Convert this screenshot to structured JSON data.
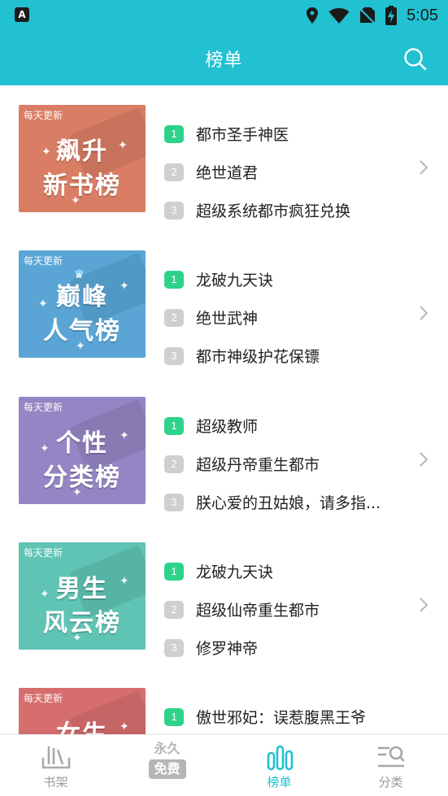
{
  "status": {
    "app_badge": "A",
    "time": "5:05"
  },
  "appbar": {
    "title": "榜单"
  },
  "colors": {
    "primary": "#22C1D2",
    "badge_first": "#2DD38A",
    "badge_other": "#CFCFCF"
  },
  "rankings": [
    {
      "cover_tag": "每天更新",
      "cover_line1": "飙升",
      "cover_line2": "新书榜",
      "cover_color": "#D97D64",
      "items": [
        {
          "rank": "1",
          "title": "都市圣手神医"
        },
        {
          "rank": "2",
          "title": "绝世道君"
        },
        {
          "rank": "3",
          "title": "超级系统都市疯狂兑换"
        }
      ]
    },
    {
      "cover_tag": "每天更新",
      "cover_line1": "巅峰",
      "cover_line2": "人气榜",
      "cover_color": "#5AA5D6",
      "items": [
        {
          "rank": "1",
          "title": "龙破九天诀"
        },
        {
          "rank": "2",
          "title": "绝世武神"
        },
        {
          "rank": "3",
          "title": "都市神级护花保镖"
        }
      ]
    },
    {
      "cover_tag": "每天更新",
      "cover_line1": "个性",
      "cover_line2": "分类榜",
      "cover_color": "#9486C4",
      "items": [
        {
          "rank": "1",
          "title": "超级教师"
        },
        {
          "rank": "2",
          "title": "超级丹帝重生都市"
        },
        {
          "rank": "3",
          "title": "朕心爱的丑姑娘，请多指..."
        }
      ]
    },
    {
      "cover_tag": "每天更新",
      "cover_line1": "男生",
      "cover_line2": "风云榜",
      "cover_color": "#5FC4B4",
      "items": [
        {
          "rank": "1",
          "title": "龙破九天诀"
        },
        {
          "rank": "2",
          "title": "超级仙帝重生都市"
        },
        {
          "rank": "3",
          "title": "修罗神帝"
        }
      ]
    },
    {
      "cover_tag": "每天更新",
      "cover_line1": "女生",
      "cover_line2": "",
      "cover_color": "#D66E6E",
      "items": [
        {
          "rank": "1",
          "title": "傲世邪妃：误惹腹黑王爷"
        }
      ]
    }
  ],
  "bottom_nav": {
    "tabs": [
      {
        "label": "书架",
        "icon": "bookshelf-icon"
      },
      {
        "label": "",
        "icon": "free-forever-icon",
        "icon_text1": "永久",
        "icon_text2": "免费"
      },
      {
        "label": "榜单",
        "icon": "ranking-icon"
      },
      {
        "label": "分类",
        "icon": "category-icon"
      }
    ]
  }
}
